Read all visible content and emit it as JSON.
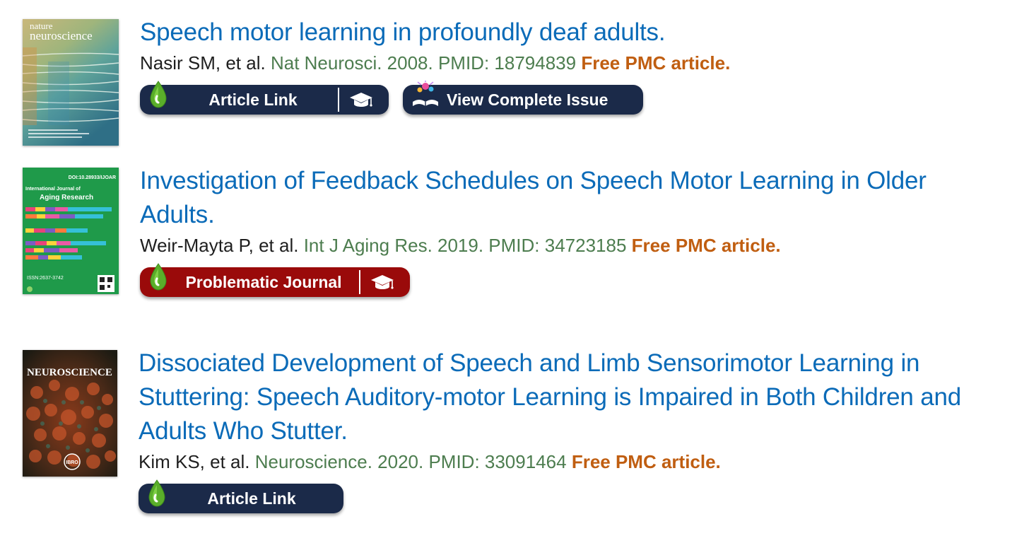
{
  "results": [
    {
      "title": "Speech motor learning in profoundly deaf adults.",
      "authors": "Nasir SM, et al.",
      "citation": "Nat Neurosci. 2008. PMID: 18794839",
      "free": "Free PMC article.",
      "cover": {
        "line1": "nature",
        "line2": "neuroscience"
      },
      "badges": {
        "article": "Article Link",
        "issue": "View Complete Issue"
      }
    },
    {
      "title_line1": "Investigation of Feedback Schedules on Speech Motor Learning in Older",
      "title_line2": "Adults.",
      "authors": "Weir-Mayta P, et al.",
      "citation": "Int J Aging Res. 2019. PMID: 34723185",
      "free": "Free PMC article.",
      "cover": {
        "doi": "DOI:10.28933/IJOAR",
        "line1": "International Journal of",
        "line2": "Aging Research",
        "issn": "ISSN:2637-3742"
      },
      "badges": {
        "problematic": "Problematic Journal"
      }
    },
    {
      "title_line1": "Dissociated Development of Speech and Limb Sensorimotor Learning in",
      "title_line2": "Stuttering: Speech Auditory-motor Learning is Impaired in Both Children and",
      "title_line3": "Adults Who Stutter.",
      "authors": "Kim KS, et al.",
      "citation": "Neuroscience. 2020. PMID: 33091464",
      "free": "Free PMC article.",
      "cover": {
        "line1": "NEUROSCIENCE",
        "logo": "IBRO"
      },
      "badges": {
        "article": "Article Link"
      }
    }
  ],
  "colors": {
    "title": "#0b6bb8",
    "journal": "#4d7d4f",
    "free": "#c05e11",
    "badge_navy": "#1b2a49",
    "badge_red": "#9a0a0a",
    "drop_green": "#5aae2a"
  },
  "icons": [
    "drop-icon",
    "graduation-cap-icon",
    "book-icon"
  ]
}
